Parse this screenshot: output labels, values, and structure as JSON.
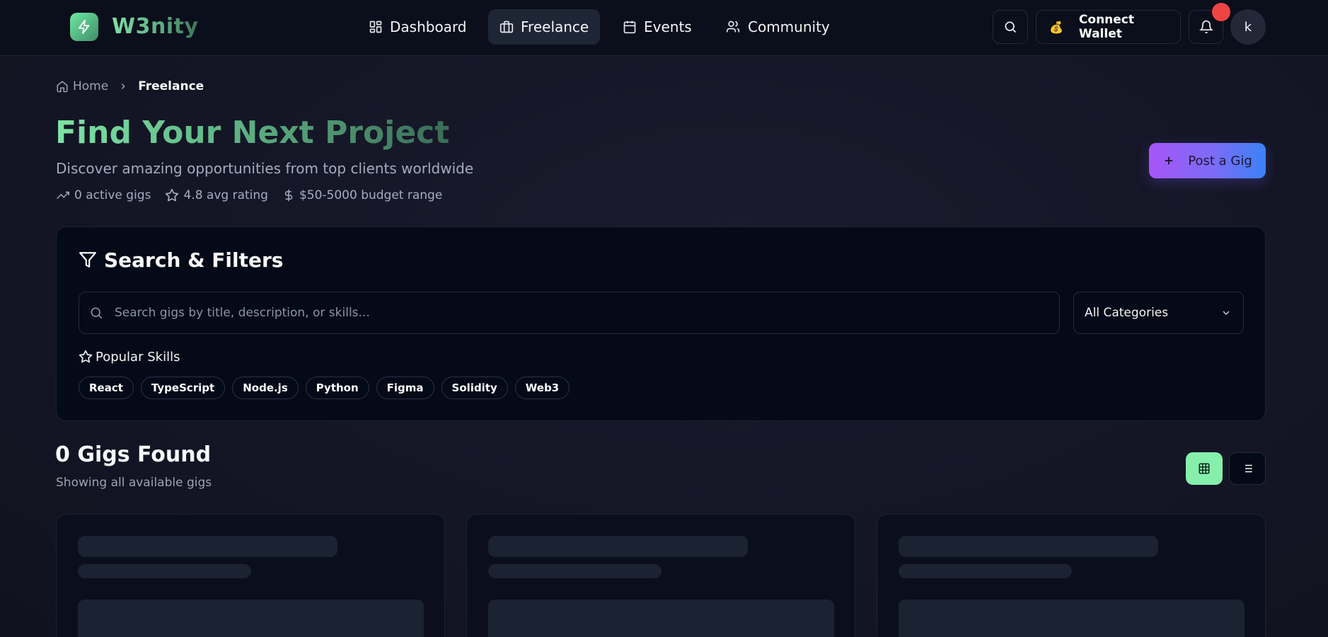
{
  "header": {
    "logo_text": "W3nity",
    "logo_icon": "lightning-bolt-icon",
    "nav": [
      {
        "label": "Dashboard",
        "icon": "layout-grid-icon",
        "active": false
      },
      {
        "label": "Freelance",
        "icon": "briefcase-icon",
        "active": true
      },
      {
        "label": "Events",
        "icon": "calendar-icon",
        "active": false
      },
      {
        "label": "Community",
        "icon": "users-icon",
        "active": false
      }
    ],
    "search_icon": "search-icon",
    "wallet": {
      "emoji": "💰",
      "label": "Connect Wallet"
    },
    "notifications_icon": "bell-icon",
    "avatar_initial": "k"
  },
  "breadcrumb": {
    "home": "Home",
    "current": "Freelance"
  },
  "hero": {
    "title": "Find Your Next Project",
    "subtitle": "Discover amazing opportunities from top clients worldwide",
    "stats": [
      {
        "icon": "trending-up-icon",
        "text": "0 active gigs"
      },
      {
        "icon": "star-icon",
        "text": "4.8 avg rating"
      },
      {
        "icon": "dollar-icon",
        "text": "$50-5000 budget range"
      }
    ],
    "post_button": "Post a Gig"
  },
  "filters": {
    "title": "Search & Filters",
    "search_placeholder": "Search gigs by title, description, or skills...",
    "category_selected": "All Categories",
    "popular_skills_label": "Popular Skills",
    "skills": [
      "React",
      "TypeScript",
      "Node.js",
      "Python",
      "Figma",
      "Solidity",
      "Web3"
    ]
  },
  "results": {
    "title": "0 Gigs Found",
    "subtitle": "Showing all available gigs",
    "view_mode": "grid"
  },
  "colors": {
    "accent_green": "#86efac",
    "gradient_purple": "#a855f7",
    "gradient_blue": "#3b82f6",
    "notification_red": "#ef4444",
    "background": "#141625"
  }
}
